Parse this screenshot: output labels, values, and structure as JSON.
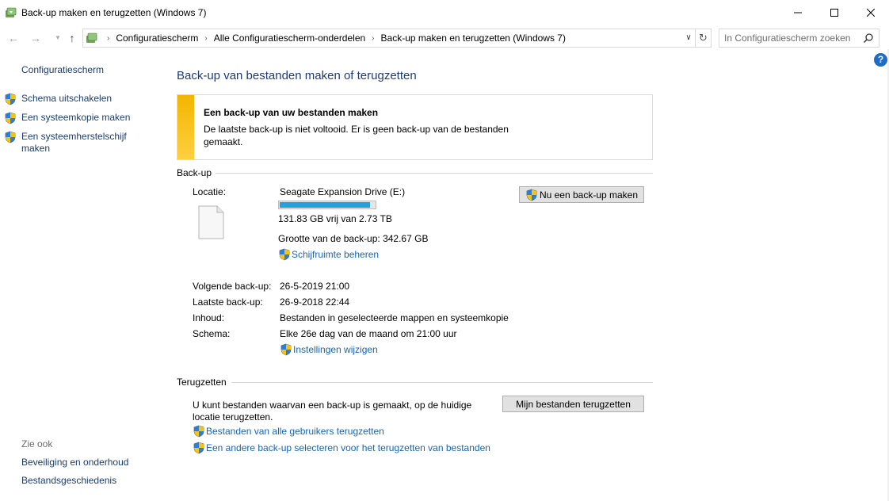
{
  "window": {
    "title": "Back-up maken en terugzetten (Windows 7)"
  },
  "address": {
    "crumbs": [
      "Configuratiescherm",
      "Alle Configuratiescherm-onderdelen",
      "Back-up maken en terugzetten (Windows 7)"
    ],
    "search_placeholder": "In Configuratiescherm zoeken"
  },
  "sidebar": {
    "home": "Configuratiescherm",
    "tasks": [
      "Schema uitschakelen",
      "Een systeemkopie maken",
      "Een systeemherstelschijf maken"
    ],
    "see_also_label": "Zie ook",
    "see_also": [
      "Beveiliging en onderhoud",
      "Bestandsgeschiedenis"
    ]
  },
  "main": {
    "title": "Back-up van bestanden maken of terugzetten",
    "warning": {
      "title": "Een back-up van uw bestanden maken",
      "text": "De laatste back-up is niet voltooid. Er is geen back-up van de bestanden gemaakt."
    },
    "backup": {
      "header": "Back-up",
      "location_label": "Locatie:",
      "drive_name": "Seagate Expansion Drive (E:)",
      "drive_used_fraction": 0.95,
      "free_space": "131.83 GB vrij van 2.73 TB",
      "backup_size": "Grootte van de back-up: 342.67 GB",
      "manage_space_link": "Schijfruimte beheren",
      "backup_now_button": "Nu een back-up maken",
      "next_label": "Volgende back-up:",
      "next_value": "26-5-2019 21:00",
      "last_label": "Laatste back-up:",
      "last_value": "26-9-2018 22:44",
      "contents_label": "Inhoud:",
      "contents_value": "Bestanden in geselecteerde mappen en systeemkopie",
      "schedule_label": "Schema:",
      "schedule_value": "Elke 26e dag van de maand om 21:00 uur",
      "change_settings_link": "Instellingen wijzigen"
    },
    "restore": {
      "header": "Terugzetten",
      "text": "U kunt bestanden waarvan een back-up is gemaakt, op de huidige locatie terugzetten.",
      "restore_button": "Mijn bestanden terugzetten",
      "all_users_link": "Bestanden van alle gebruikers terugzetten",
      "select_other_link": "Een andere back-up selecteren voor het terugzetten van bestanden"
    }
  },
  "colors": {
    "link": "#1565b8",
    "nav_link": "#1a3c6e",
    "title": "#1e3a7a",
    "warning_bar": "#f2b600",
    "progress_fill": "#26a0da"
  }
}
